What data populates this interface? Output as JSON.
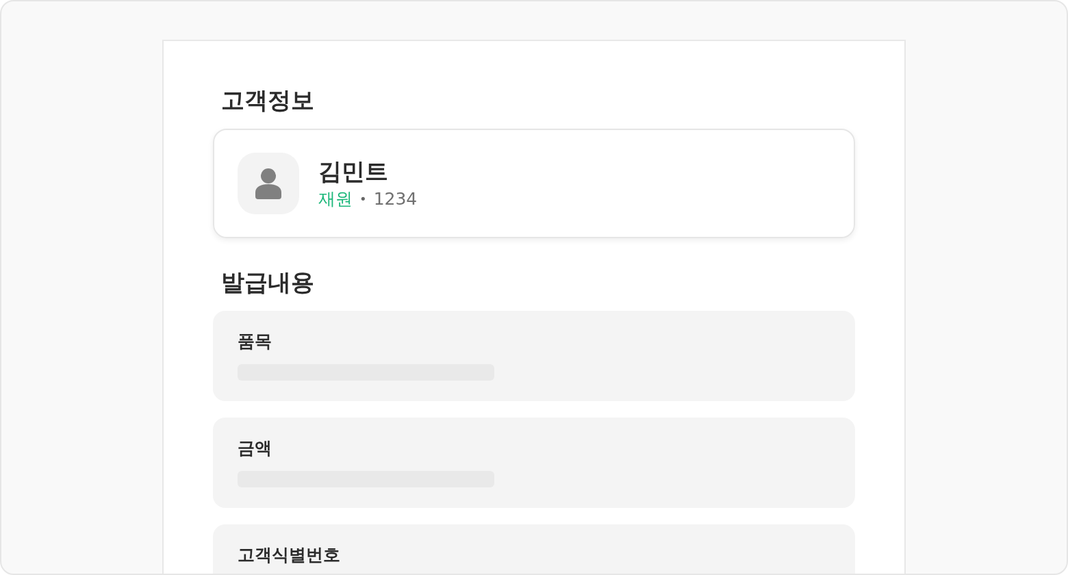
{
  "customer_section": {
    "title": "고객정보",
    "name": "김민트",
    "category": "재원",
    "separator": "•",
    "code": "1234"
  },
  "issue_section": {
    "title": "발급내용",
    "fields": [
      {
        "label": "품목"
      },
      {
        "label": "금액"
      },
      {
        "label": "고객식별번호"
      }
    ]
  }
}
